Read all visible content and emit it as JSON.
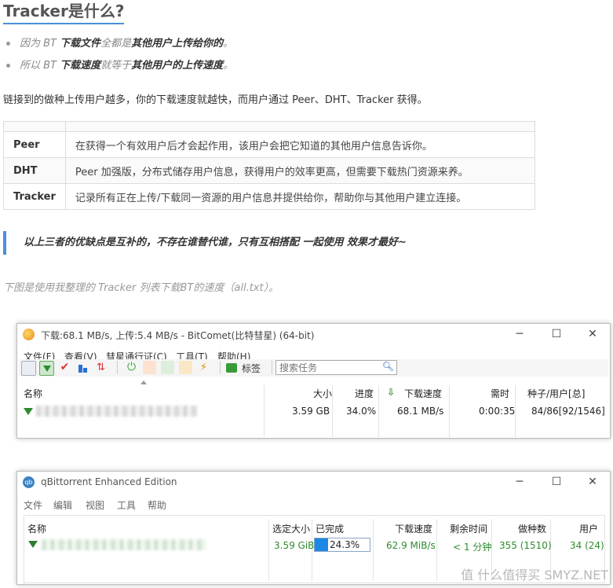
{
  "article": {
    "title": "Tracker是什么?",
    "bullets": [
      {
        "p1": "因为 BT ",
        "b1": "下载文件",
        "p2": "全都是",
        "b2": "其他用户上传给你的",
        "p3": "。"
      },
      {
        "p1": "所以 BT ",
        "b1": "下载速度",
        "p2": "就等于",
        "b2": "其他用户的上传速度",
        "p3": "。"
      }
    ],
    "intro": "链接到的做种上传用户越多，你的下载速度就越快，而用户通过 Peer、DHT、Tracker 获得。",
    "table": [
      {
        "key": "Peer",
        "value": "在获得一个有效用户后才会起作用，该用户会把它知道的其他用户信息告诉你。"
      },
      {
        "key": "DHT",
        "value": "Peer 加强版，分布式储存用户信息，获得用户的效率更高，但需要下载热门资源来养。"
      },
      {
        "key": "Tracker",
        "value": "记录所有正在上传/下载同一资源的用户信息并提供给你，帮助你与其他用户建立连接。"
      }
    ],
    "quote": "以上三者的优缺点是互补的，不存在谁替代谁，只有互相搭配 一起使用 效果才最好~",
    "caption": "下图是使用我整理的 Tracker 列表下载BT的速度（all.txt）。"
  },
  "bitcomet": {
    "title": "下载:68.1 MB/s, 上传:5.4 MB/s - BitComet(比特彗星) (64-bit)",
    "menu": [
      "查看(V)",
      "彗星通行证(C)",
      "工具(T)",
      "帮助(H)"
    ],
    "menu_file": "文件(F)",
    "tag_label": "标签",
    "search_placeholder": "搜索任务",
    "headers": {
      "name": "名称",
      "size": "大小",
      "progress": "进度",
      "down": "下载速度",
      "time": "需时",
      "seeds": "种子/用户[总]"
    },
    "row": {
      "size": "3.59 GB",
      "progress": "34.0%",
      "down": "68.1 MB/s",
      "time": "0:00:35",
      "seeds": "84/86[92/1546]"
    }
  },
  "qbittorrent": {
    "title": "qBittorrent Enhanced Edition",
    "menu": [
      "文件",
      "编辑",
      "视图",
      "工具",
      "帮助"
    ],
    "headers": {
      "name": "名称",
      "size": "选定大小",
      "done": "已完成",
      "down": "下载速度",
      "eta": "剩余时间",
      "seeds": "做种数",
      "peers": "用户"
    },
    "row": {
      "size": "3.59 GiB",
      "progress": 0.243,
      "done": "24.3%",
      "down": "62.9 MiB/s",
      "eta": "< 1 分钟",
      "seeds": "355 (1510)",
      "peers": "34 (24)"
    }
  },
  "watermark": "值 什么值得买 SMYZ.NET",
  "colors": {
    "accent": "#4a90d9",
    "green": "#2e8b2e",
    "progress": "#1e88e5"
  }
}
